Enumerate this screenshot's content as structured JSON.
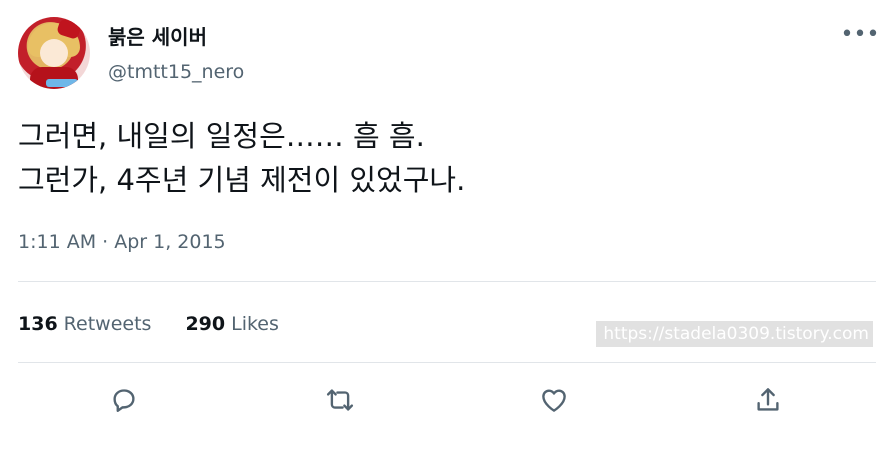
{
  "author": {
    "display_name": "붉은 세이버",
    "handle": "@tmtt15_nero"
  },
  "tweet": {
    "lines": [
      "그러면, 내일의 일정은…… 흠 흠.",
      "그런가, 4주년 기념 제전이 있었구나."
    ],
    "timestamp": "1:11 AM · Apr 1, 2015"
  },
  "stats": {
    "retweets_count": "136",
    "retweets_label": "Retweets",
    "likes_count": "290",
    "likes_label": "Likes"
  },
  "watermark": "https://stadela0309.tistory.com",
  "icons": {
    "more": "more-horizontal-icon",
    "reply": "reply-icon",
    "retweet": "retweet-icon",
    "like": "heart-icon",
    "share": "share-icon"
  }
}
